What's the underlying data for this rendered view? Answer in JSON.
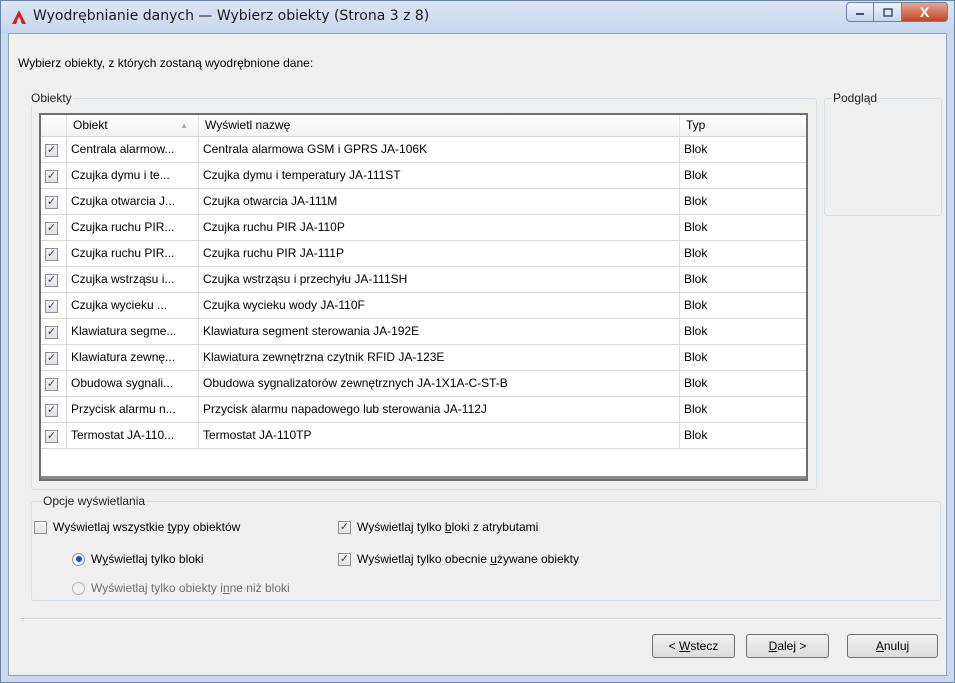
{
  "window": {
    "title": "Wyodrębnianie danych — Wybierz obiekty (Strona 3 z 8)",
    "buttons": {
      "minimize": "–",
      "maximize": "□",
      "close": "X"
    }
  },
  "intro": "Wybierz obiekty, z których zostaną wyodrębnione dane:",
  "objects_group": {
    "label": "Obiekty",
    "columns": [
      "Obiekt",
      "Wyświetl nazwę",
      "Typ"
    ],
    "sort_indicator": "▲",
    "rows": [
      {
        "checked": true,
        "object": "Centrala alarmow...",
        "name": "Centrala alarmowa GSM i GPRS JA-106K",
        "type": "Blok"
      },
      {
        "checked": true,
        "object": "Czujka dymu i te...",
        "name": "Czujka dymu i temperatury JA-111ST",
        "type": "Blok"
      },
      {
        "checked": true,
        "object": "Czujka otwarcia J...",
        "name": "Czujka otwarcia JA-111M",
        "type": "Blok"
      },
      {
        "checked": true,
        "object": "Czujka ruchu PIR...",
        "name": "Czujka ruchu PIR JA-110P",
        "type": "Blok"
      },
      {
        "checked": true,
        "object": "Czujka ruchu PIR...",
        "name": "Czujka ruchu PIR JA-111P",
        "type": "Blok"
      },
      {
        "checked": true,
        "object": "Czujka wstrząsu i...",
        "name": "Czujka wstrząsu i przechyłu JA-111SH",
        "type": "Blok"
      },
      {
        "checked": true,
        "object": "Czujka wycieku ...",
        "name": "Czujka wycieku wody JA-110F",
        "type": "Blok"
      },
      {
        "checked": true,
        "object": "Klawiatura segme...",
        "name": "Klawiatura segment sterowania JA-192E",
        "type": "Blok"
      },
      {
        "checked": true,
        "object": "Klawiatura zewnę...",
        "name": "Klawiatura zewnętrzna czytnik RFID JA-123E",
        "type": "Blok"
      },
      {
        "checked": true,
        "object": "Obudowa sygnali...",
        "name": "Obudowa sygnalizatorów zewnętrznych JA-1X1A-C-ST-B",
        "type": "Blok"
      },
      {
        "checked": true,
        "object": "Przycisk alarmu n...",
        "name": "Przycisk alarmu napadowego lub sterowania JA-112J",
        "type": "Blok"
      },
      {
        "checked": true,
        "object": "Termostat JA-110...",
        "name": "Termostat JA-110TP",
        "type": "Blok"
      }
    ]
  },
  "preview_group": {
    "label": "Podgląd"
  },
  "display_options": {
    "label": "Opcje wyświetlania",
    "all_types": {
      "pre": "Wyświetlaj wszystkie ",
      "u": "t",
      "post": "ypy obiektów",
      "checked": false
    },
    "only_blocks": {
      "pre": "W",
      "u": "y",
      "post": "świetlaj tylko bloki",
      "selected": true
    },
    "non_blocks": {
      "pre": "Wyświetlaj tylko obiekty i",
      "u": "n",
      "post": "ne niż bloki",
      "selected": false
    },
    "with_attributes": {
      "pre": "Wyświetlaj tylko ",
      "u": "b",
      "post": "loki z atrybutami",
      "checked": true
    },
    "in_use": {
      "pre": "Wyświetlaj tylko obecnie ",
      "u": "u",
      "post": "żywane obiekty",
      "checked": true
    }
  },
  "footer": {
    "back": {
      "pre": "< ",
      "u": "W",
      "post": "stecz"
    },
    "next": {
      "pre": "",
      "u": "D",
      "post": "alej >"
    },
    "cancel": {
      "pre": "",
      "u": "A",
      "post": "nuluj"
    }
  },
  "colors": {
    "title_bg": "#c9d9ee",
    "close_red": "#c3442a",
    "client_bg": "#f0f0f0"
  }
}
